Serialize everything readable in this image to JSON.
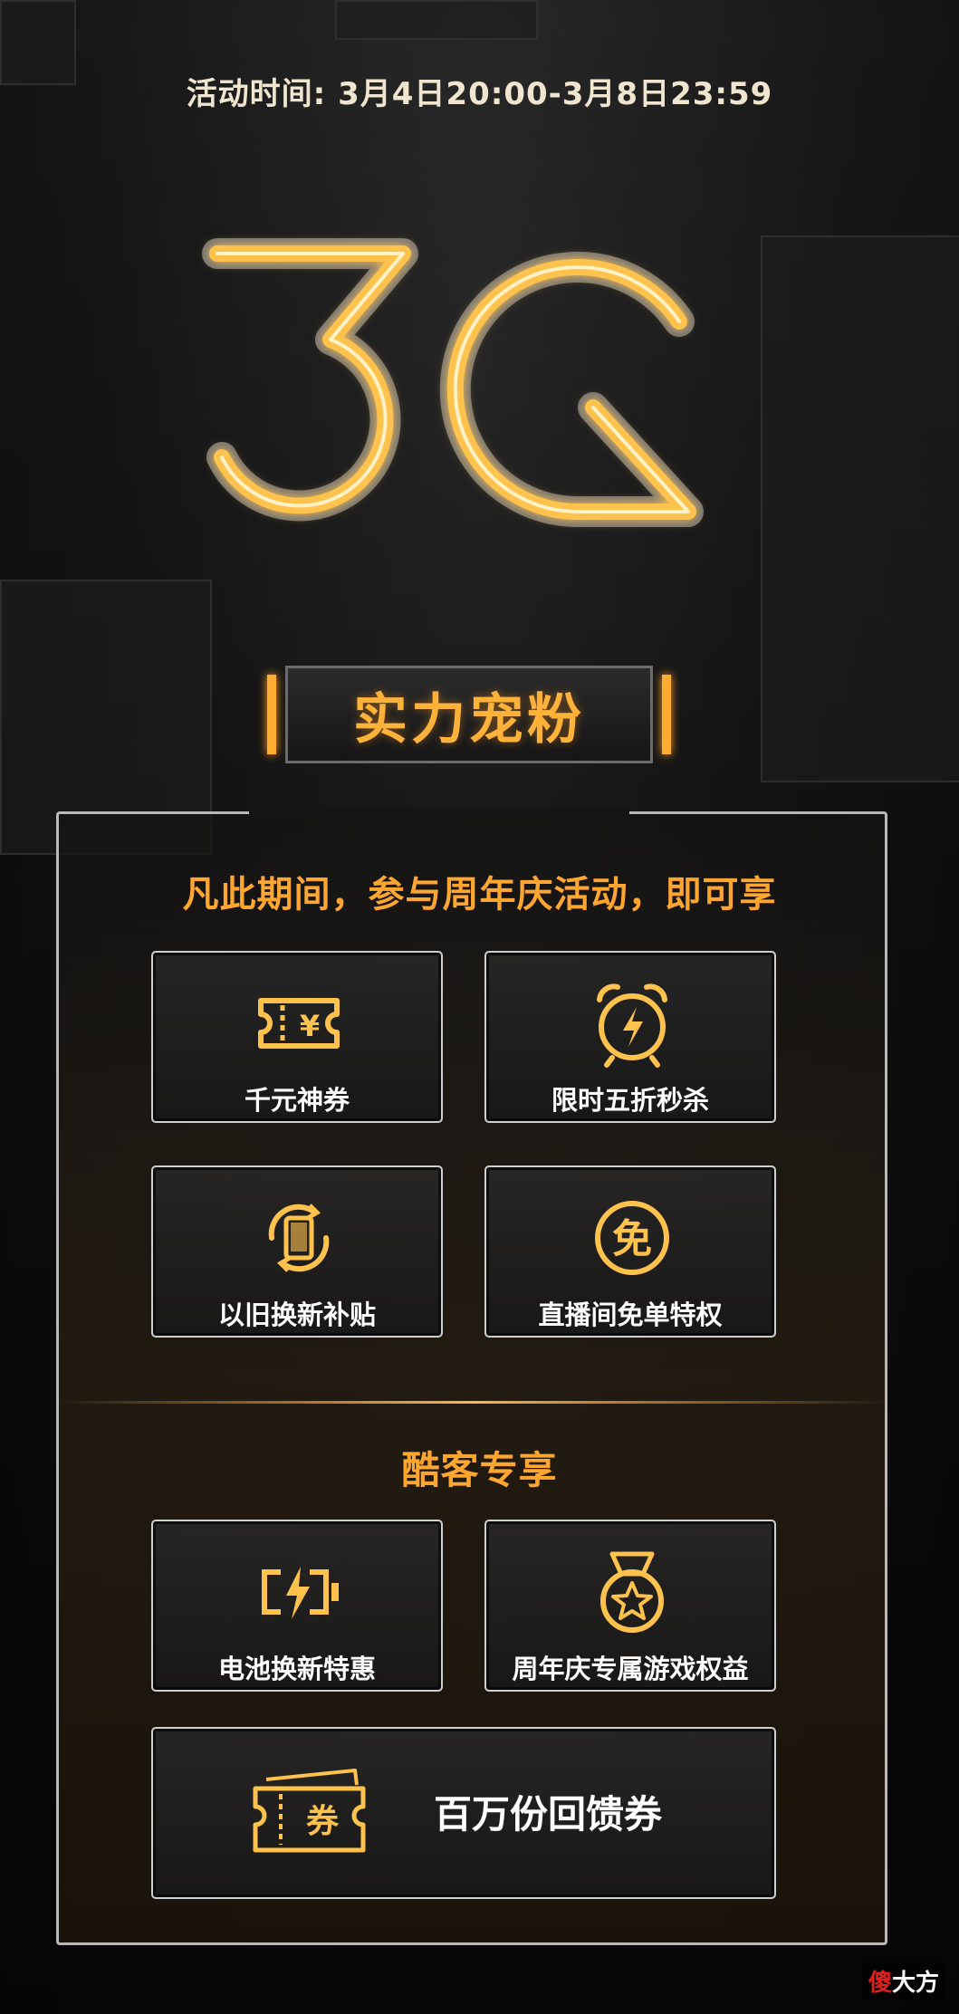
{
  "event_time": "活动时间: 3月4日20:00-3月8日23:59",
  "logo": {
    "text": "3G",
    "color": "#ffc24d"
  },
  "title": "实力宠粉",
  "section1": {
    "heading": "凡此期间，参与周年庆活动，即可享",
    "cards": [
      {
        "label": "千元神券",
        "icon": "coupon-yen-icon"
      },
      {
        "label": "限时五折秒杀",
        "icon": "alarm-clock-lightning-icon"
      },
      {
        "label": "以旧换新补贴",
        "icon": "phone-exchange-icon"
      },
      {
        "label": "直播间免单特权",
        "icon": "free-badge-icon"
      }
    ]
  },
  "section2": {
    "heading": "酷客专享",
    "cards": [
      {
        "label": "电池换新特惠",
        "icon": "battery-charge-icon"
      },
      {
        "label": "周年庆专属游戏权益",
        "icon": "medal-star-icon"
      }
    ],
    "wide_card": {
      "label": "百万份回馈券",
      "icon": "voucher-ticket-icon",
      "icon_text": "券"
    }
  },
  "watermark": {
    "red": "傻",
    "rest": "大方"
  },
  "colors": {
    "accent": "#ffa630",
    "gold": "#ffc24d",
    "background": "#151515"
  }
}
